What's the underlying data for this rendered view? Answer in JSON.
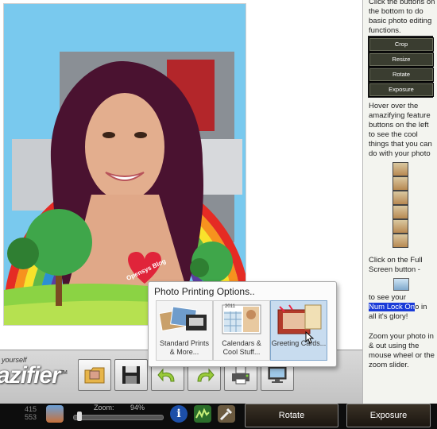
{
  "right_panel": {
    "intro_text": "Click the buttons on the bottom to do basic photo editing functions.",
    "buttons": [
      "Crop",
      "Resize",
      "Rotate",
      "Exposure"
    ],
    "hover_text": "Hover over the amazifying feature buttons on the left to see the cool things that you can do with your photo",
    "fullscreen_text_1": "Click on the Full Screen button -",
    "fullscreen_text_2": "to see your",
    "highlight_text": "Num Lock On",
    "fullscreen_text_3": "o in all it's glory!",
    "zoom_text": "Zoom your photo in & out using the mouse wheel or the zoom slider."
  },
  "photo": {
    "watermark": "Opensys Blog"
  },
  "toolbar": {
    "brand_small": "yourself",
    "brand": "azifier",
    "brand_tm": "TM"
  },
  "popup": {
    "title": "Photo Printing Options..",
    "options": [
      {
        "label": "Standard Prints & More..."
      },
      {
        "label": "Calendars & Cool Stuff..."
      },
      {
        "label": "Greeting Cards..."
      }
    ],
    "calendar_year": "2011"
  },
  "statusbar": {
    "width": "415",
    "height": "553",
    "zoom_label": "Zoom:",
    "zoom_value": "94%",
    "zoom_level_percent": 5,
    "rotate_label": "Rotate",
    "exposure_label": "Exposure"
  },
  "colors": {
    "panel_button_bg": "#3a3d30",
    "highlight": "#1a3bd8",
    "status_button_bg": "#2a2318"
  }
}
